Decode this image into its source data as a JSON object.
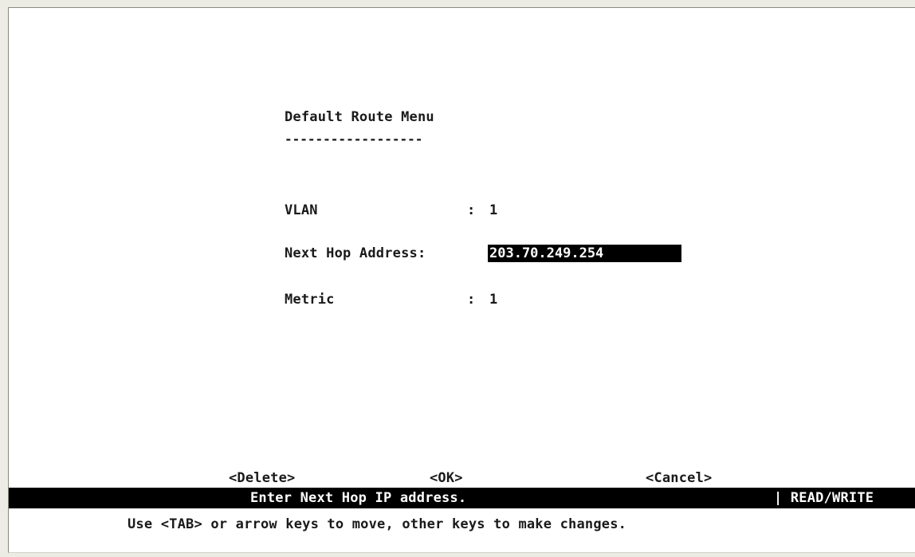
{
  "menu": {
    "title": "Default Route Menu",
    "title_underline": "------------------"
  },
  "fields": {
    "vlan": {
      "label": "VLAN",
      "separator": ":",
      "value": "1"
    },
    "next_hop": {
      "label": "Next Hop Address:",
      "value": "203.70.249.254"
    },
    "metric": {
      "label": "Metric",
      "separator": ":",
      "value": "1"
    }
  },
  "actions": {
    "delete_label": "<Delete>",
    "ok_label": "<OK>",
    "cancel_label": "<Cancel>"
  },
  "status": {
    "message": "Enter Next Hop IP address.",
    "mode": "| READ/WRITE"
  },
  "help": {
    "text": "Use <TAB> or arrow keys to move, other keys to make changes."
  },
  "colors": {
    "background": "#ffffff",
    "text": "#1a1a1a",
    "status_bar": "#000000",
    "highlight": "#000000",
    "window_chrome": "#ecece4"
  }
}
